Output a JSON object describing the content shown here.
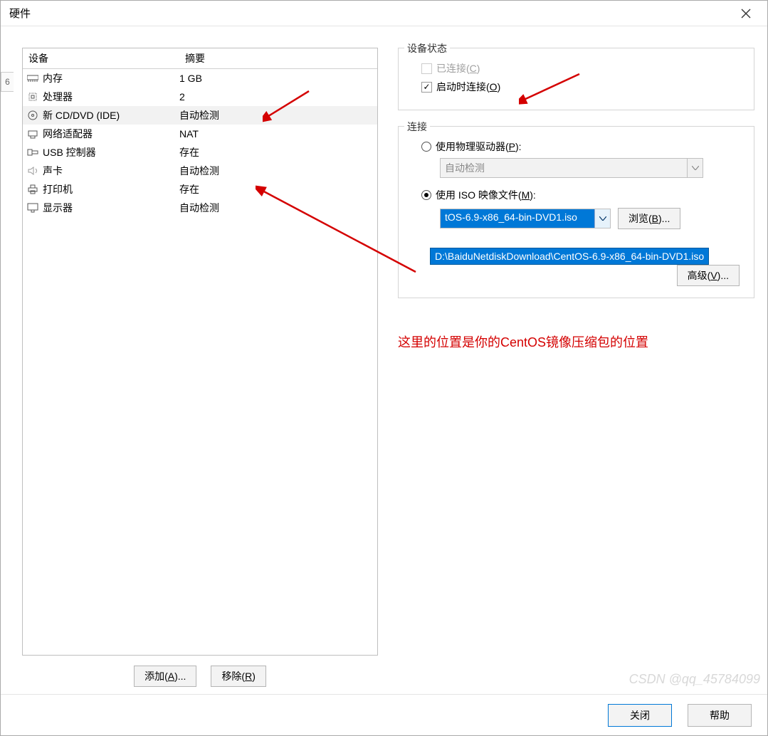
{
  "title": "硬件",
  "columns": {
    "device": "设备",
    "summary": "摘要"
  },
  "devices": [
    {
      "name": "内存",
      "summary": "1 GB",
      "icon": "memory"
    },
    {
      "name": "处理器",
      "summary": "2",
      "icon": "cpu"
    },
    {
      "name": "新 CD/DVD (IDE)",
      "summary": "自动检测",
      "icon": "disc",
      "selected": true
    },
    {
      "name": "网络适配器",
      "summary": "NAT",
      "icon": "network"
    },
    {
      "name": "USB 控制器",
      "summary": "存在",
      "icon": "usb"
    },
    {
      "name": "声卡",
      "summary": "自动检测",
      "icon": "sound"
    },
    {
      "name": "打印机",
      "summary": "存在",
      "icon": "printer"
    },
    {
      "name": "显示器",
      "summary": "自动检测",
      "icon": "display"
    }
  ],
  "status": {
    "legend": "设备状态",
    "connected": "已连接",
    "connected_k": "(C)",
    "connect_on": "启动时连接",
    "connect_on_k": "(O)"
  },
  "connection": {
    "legend": "连接",
    "physical": "使用物理驱动器",
    "physical_k": "(P)",
    "physical_value": "自动检测",
    "iso": "使用 ISO 映像文件",
    "iso_k": "(M)",
    "iso_value": "tOS-6.9-x86_64-bin-DVD1.iso",
    "iso_dropdown": "D:\\BaiduNetdiskDownload\\CentOS-6.9-x86_64-bin-DVD1.iso",
    "browse": "浏览",
    "browse_k": "(B)",
    "advanced": "高级",
    "advanced_k": "(V)"
  },
  "annotation": "这里的位置是你的CentOS镜像压缩包的位置",
  "buttons": {
    "add": "添加",
    "add_k": "(A)",
    "remove": "移除",
    "remove_k": "(R)",
    "close": "关闭",
    "help": "帮助"
  },
  "watermark": "CSDN @qq_45784099",
  "bg_tab": "6"
}
